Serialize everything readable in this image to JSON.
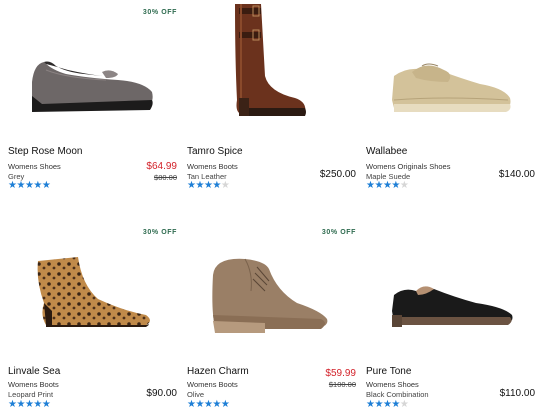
{
  "products": [
    {
      "badge": "30% OFF",
      "name": "Step Rose Moon",
      "category": "Womens Shoes",
      "color": "Grey",
      "rating": 5,
      "price_sale": "$64.99",
      "price_was": "$80.00",
      "icon": "grey-wedge-loafer-image"
    },
    {
      "badge": "",
      "name": "Tamro Spice",
      "category": "Womens Boots",
      "color": "Tan Leather",
      "rating": 4,
      "price": "$250.00",
      "icon": "tall-brown-riding-boot-image"
    },
    {
      "badge": "",
      "name": "Wallabee",
      "category": "Womens Originals Shoes",
      "color": "Maple Suede",
      "rating": 4,
      "price": "$140.00",
      "icon": "maple-suede-moccasin-image"
    },
    {
      "badge": "30% OFF",
      "name": "Linvale Sea",
      "category": "Womens Boots",
      "color": "Leopard Print",
      "rating": 5,
      "price": "$90.00",
      "icon": "leopard-ankle-boot-image"
    },
    {
      "badge": "30% OFF",
      "name": "Hazen Charm",
      "category": "Womens Boots",
      "color": "Olive",
      "rating": 5,
      "price_sale": "$59.99",
      "price_was": "$100.00",
      "icon": "olive-wedge-bootie-image"
    },
    {
      "badge": "",
      "name": "Pure Tone",
      "category": "Womens Shoes",
      "color": "Black Combination",
      "rating": 4,
      "price": "$110.00",
      "icon": "black-flat-shoe-image"
    }
  ],
  "colors": {
    "star_on": "#1e7fd6",
    "star_off": "#d6d6d6",
    "sale_price": "#d3222a",
    "badge": "#2e6b4f"
  }
}
